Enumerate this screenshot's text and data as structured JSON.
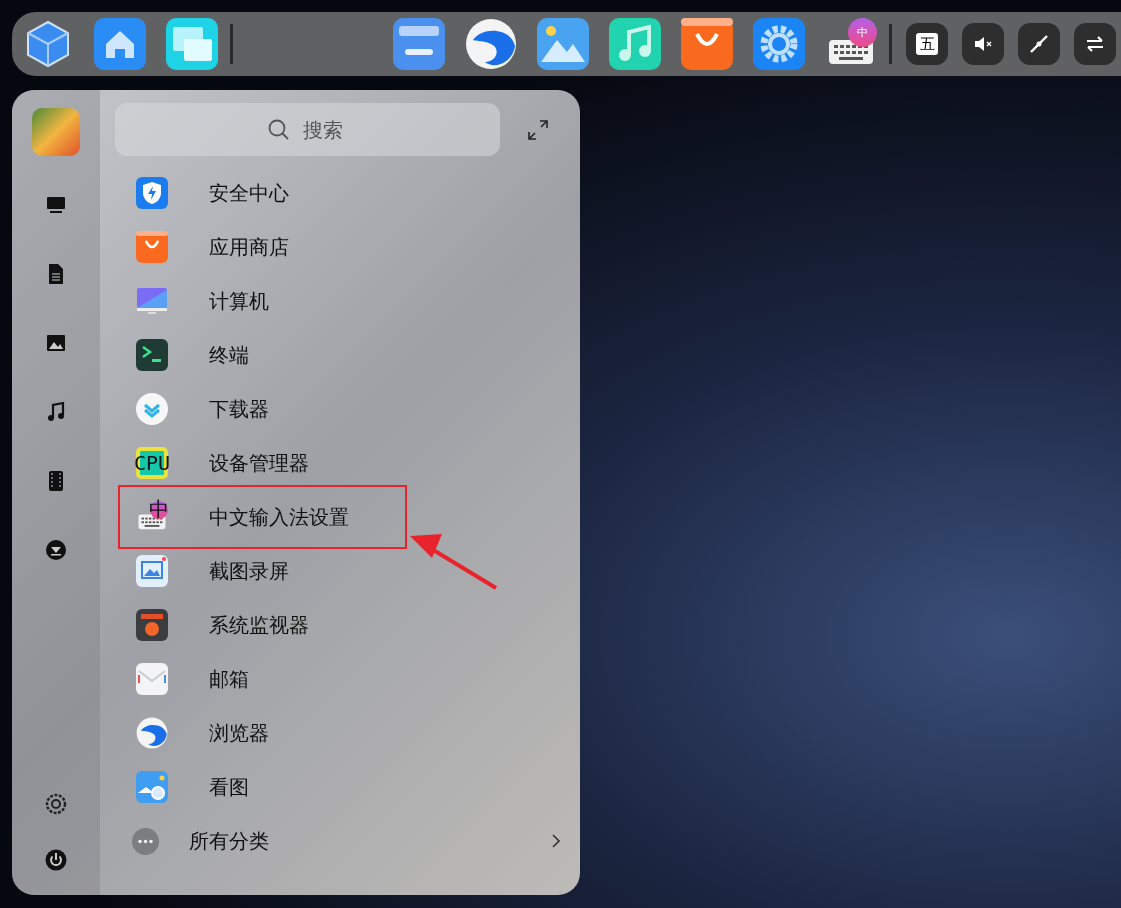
{
  "dock": {
    "left_apps": [
      {
        "kind": "cube"
      },
      {
        "kind": "home"
      },
      {
        "kind": "windows"
      }
    ],
    "center_apps": [
      {
        "kind": "folder"
      },
      {
        "kind": "browser"
      },
      {
        "kind": "photos"
      },
      {
        "kind": "music"
      },
      {
        "kind": "store"
      },
      {
        "kind": "settings"
      },
      {
        "kind": "keyboard",
        "badge": "中"
      }
    ],
    "tray": [
      {
        "kind": "text",
        "label": "五"
      },
      {
        "kind": "mute"
      },
      {
        "kind": "pen"
      },
      {
        "kind": "swap"
      }
    ]
  },
  "launcher": {
    "search": {
      "placeholder": "搜索"
    },
    "sidebar": [
      {
        "kind": "monitor"
      },
      {
        "kind": "document"
      },
      {
        "kind": "image"
      },
      {
        "kind": "music"
      },
      {
        "kind": "film"
      },
      {
        "kind": "download"
      }
    ],
    "sidebar_bottom": [
      {
        "kind": "settings"
      },
      {
        "kind": "power"
      }
    ],
    "apps": [
      {
        "label": "安全中心",
        "kind": "shield",
        "annotated": false
      },
      {
        "label": "应用商店",
        "kind": "store",
        "annotated": false
      },
      {
        "label": "计算机",
        "kind": "computer",
        "annotated": false
      },
      {
        "label": "终端",
        "kind": "terminal",
        "annotated": false
      },
      {
        "label": "下载器",
        "kind": "downloader",
        "annotated": false
      },
      {
        "label": "设备管理器",
        "kind": "cpu",
        "annotated": false,
        "chip": "CPU"
      },
      {
        "label": "中文输入法设置",
        "kind": "keyboard",
        "annotated": true,
        "badge": "中"
      },
      {
        "label": "截图录屏",
        "kind": "screenshot",
        "annotated": false
      },
      {
        "label": "系统监视器",
        "kind": "monitor-app",
        "annotated": false
      },
      {
        "label": "邮箱",
        "kind": "mail",
        "annotated": false
      },
      {
        "label": "浏览器",
        "kind": "browser",
        "annotated": false
      },
      {
        "label": "看图",
        "kind": "viewer",
        "annotated": false
      }
    ],
    "all_categories": {
      "label": "所有分类"
    }
  }
}
